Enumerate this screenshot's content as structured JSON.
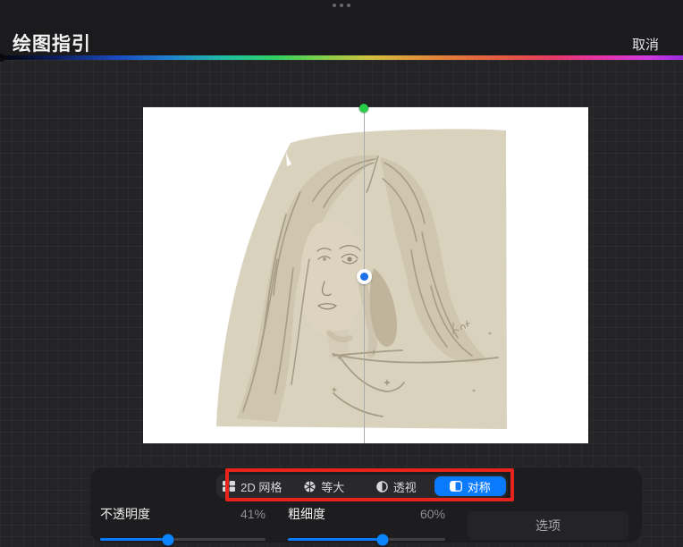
{
  "window": {
    "drag_handle": "three-dots"
  },
  "header": {
    "title": "绘图指引",
    "cancel_label": "取消"
  },
  "color_bar": {
    "description": "hue spectrum strip",
    "left_knob_color": "#0a0a0c"
  },
  "canvas": {
    "artwork_description": "pencil sketch portrait of a woman with long wavy hair on a beige wash",
    "guide": {
      "type": "symmetry",
      "axis": "vertical",
      "top_handle_color": "#27cc47",
      "center_handle_color": "#1c6fe8",
      "line_color": "#ababab"
    }
  },
  "guide_tabs": {
    "items": [
      {
        "label": "2D 网格",
        "icon": "grid-2d-icon",
        "selected": false
      },
      {
        "label": "等大",
        "icon": "isometric-icon",
        "selected": false
      },
      {
        "label": "透视",
        "icon": "perspective-icon",
        "selected": false
      },
      {
        "label": "对称",
        "icon": "symmetry-icon",
        "selected": true
      }
    ],
    "selected_color": "#0A7AFF"
  },
  "annotation": {
    "shape": "rectangle",
    "color": "#E8231D",
    "purpose": "highlights the guide type tab bar"
  },
  "panel": {
    "sliders": [
      {
        "label": "不透明度",
        "value": "41%",
        "percent": 41
      },
      {
        "label": "粗细度",
        "value": "60%",
        "percent": 60
      }
    ],
    "options_label": "选项",
    "accent_color": "#0A7AFF"
  }
}
